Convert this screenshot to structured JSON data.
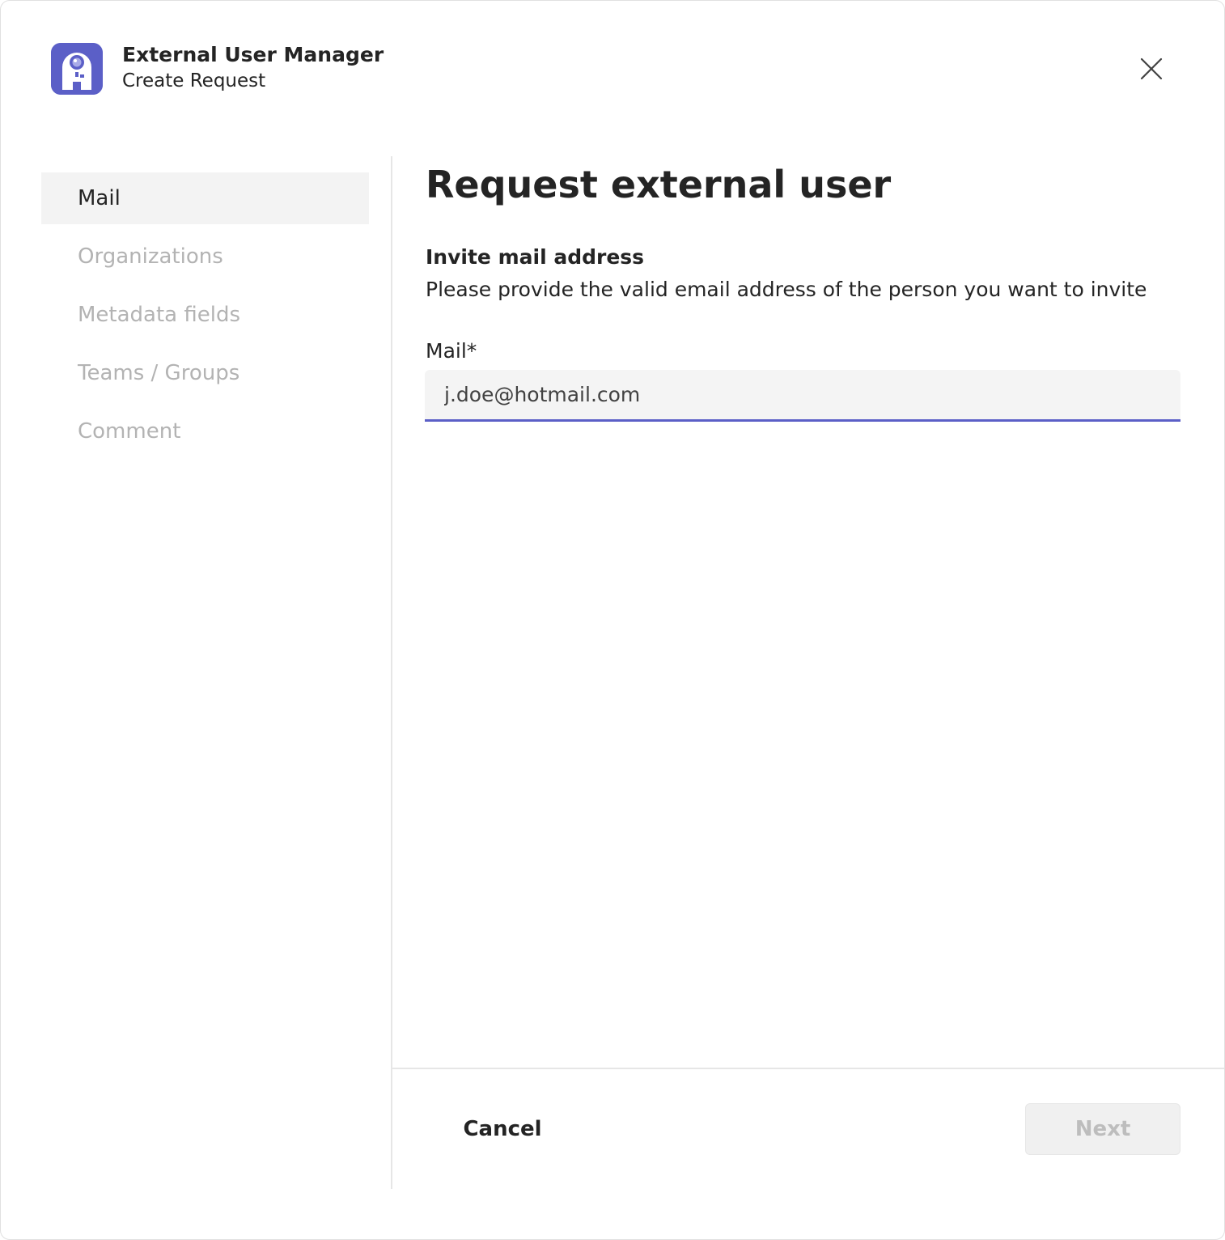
{
  "header": {
    "app_name": "External User Manager",
    "subtitle": "Create Request",
    "app_icon": "app-robot-icon",
    "close_icon": "close-icon"
  },
  "sidebar": {
    "items": [
      {
        "label": "Mail",
        "active": true
      },
      {
        "label": "Organizations",
        "active": false
      },
      {
        "label": "Metadata fields",
        "active": false
      },
      {
        "label": "Teams / Groups",
        "active": false
      },
      {
        "label": "Comment",
        "active": false
      }
    ]
  },
  "main": {
    "title": "Request external user",
    "section_title": "Invite mail address",
    "section_description": "Please provide the valid email address of the person you want to invite",
    "mail_field": {
      "label": "Mail*",
      "value": "j.doe@hotmail.com"
    }
  },
  "footer": {
    "cancel_label": "Cancel",
    "next_label": "Next",
    "next_disabled": true
  },
  "colors": {
    "accent": "#5b5fc7",
    "nav_active_bg": "#f3f3f3",
    "nav_inactive_text": "#b3b3b3"
  }
}
